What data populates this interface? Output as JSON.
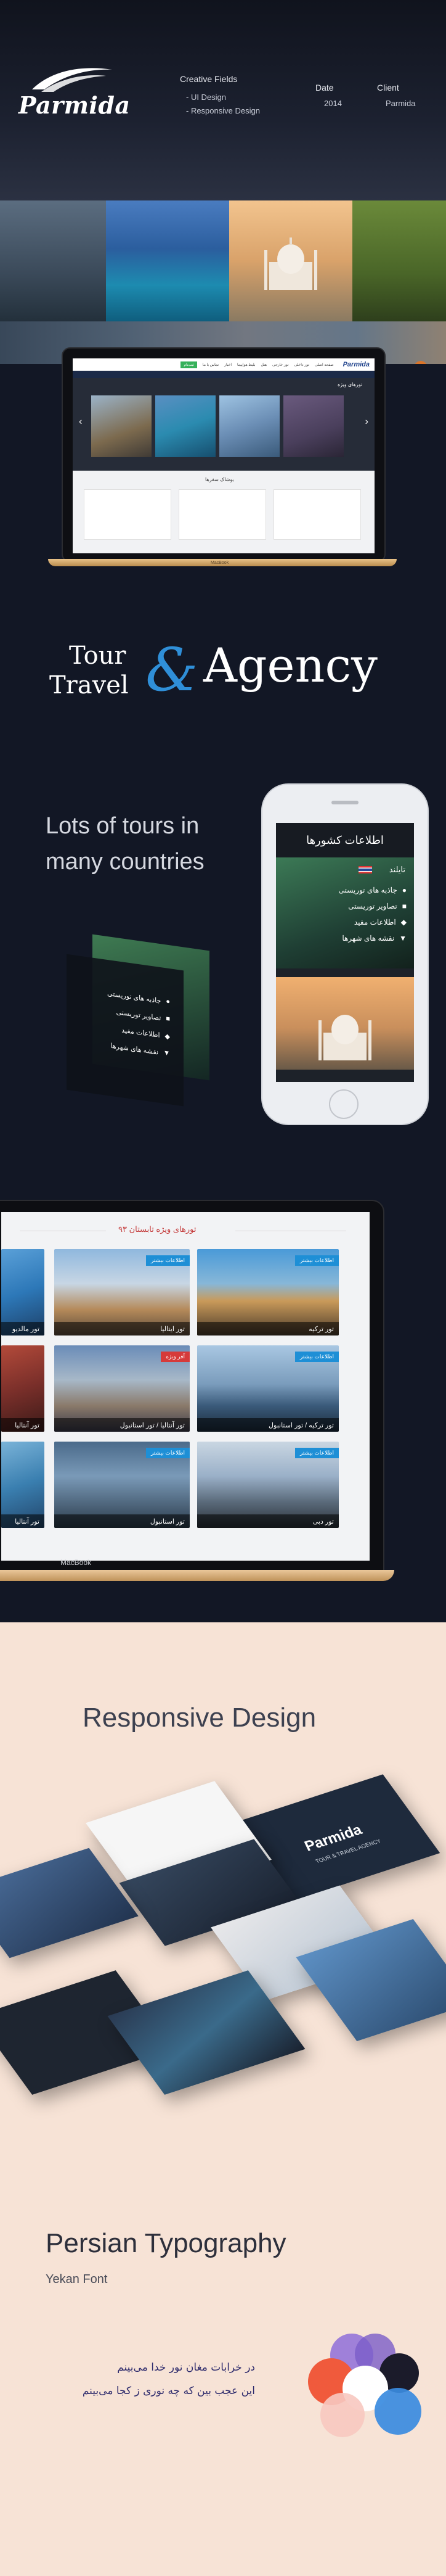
{
  "header": {
    "logo_text": "Parmida",
    "fields_title": "Creative Fields",
    "fields": [
      "- UI Design",
      "- Responsive Design"
    ],
    "date_title": "Date",
    "date_value": "2014",
    "client_title": "Client",
    "client_value": "Parmida"
  },
  "laptop1": {
    "brand": "MacBook",
    "section_special": "تورهای ویژه",
    "section_news": "بوشاک سفرها",
    "nav": [
      "صفحه اصلی",
      "تور داخلی",
      "تور خارجی",
      "هتل",
      "بلیط هواپیما",
      "اخبار",
      "تماس با ما"
    ],
    "nav_button": "ثبت‌نام"
  },
  "tour_agency": {
    "tour": "Tour",
    "travel": "Travel",
    "ampersand": "&",
    "agency": "Agency"
  },
  "lots": {
    "line1": "Lots of tours in",
    "line2": "many countries"
  },
  "phone": {
    "title": "اطلاعات کشورها",
    "country": "تایلند",
    "menu": [
      "جاذبه های توریستی",
      "تصاویر توریستی",
      "اطلاعات مفید",
      "نقشه های شهرها"
    ]
  },
  "float_menu": [
    "جاذبه های توریستی",
    "تصاویر توریستی",
    "اطلاعات مفید",
    "نقشه های شهرها"
  ],
  "laptop2": {
    "heading": "تورهای ویژه تابستان ۹۳",
    "brand": "MacBook",
    "tag": "اطلاعات بیشتر",
    "tiles": [
      {
        "caption": "تور ایتالیا",
        "tag": "اطلاعات بیشتر"
      },
      {
        "caption": "تور ترکیه",
        "tag": "اطلاعات بیشتر"
      },
      {
        "caption": "تور آنتالیا / تور استانبول",
        "tag": "آفر ویژه"
      },
      {
        "caption": "تور ترکیه / تور استانبول",
        "tag": "اطلاعات بیشتر"
      },
      {
        "caption": "تور استانبول",
        "tag": "اطلاعات بیشتر"
      },
      {
        "caption": "تور دبی",
        "tag": "اطلاعات بیشتر"
      }
    ],
    "left_tiles": [
      "تور مالدیو",
      "تور آنتالیا",
      "تور آنتالیا"
    ]
  },
  "responsive": {
    "title": "Responsive Design",
    "mock_logo": "Parmida",
    "mock_caption": "TOUR & TRAVEL AGENCY"
  },
  "typography": {
    "title": "Persian Typography",
    "subtitle": "Yekan Font",
    "line1": "در خرابات مغان نور خدا می‌بینم",
    "line2": "این عجب بین که چه نوری ز کجا می‌بینم"
  },
  "palette": [
    "#f05a3c",
    "#7a5cc8",
    "#1b1b2a",
    "#3a8be0",
    "#f7c8c0",
    "#8f6fd9"
  ]
}
